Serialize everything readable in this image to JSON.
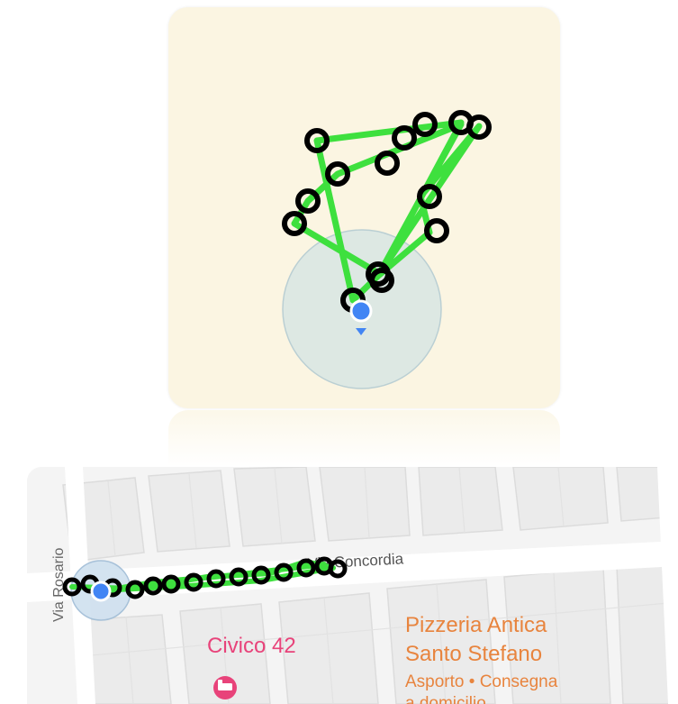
{
  "top_map": {
    "background_color": "#fbf5e2",
    "track_color": "#3ee03e",
    "marker_color": "#000000",
    "location_dot_color": "#4285f4",
    "accuracy_circle_color": "#dce8e4"
  },
  "bottom_map": {
    "streets": {
      "via_concordia": "Via Concordia",
      "via_rosario": "Via Rosario"
    },
    "places": {
      "civico": "Civico 42",
      "pizzeria_line1": "Pizzeria Antica",
      "pizzeria_line2": "Santo Stefano",
      "pizzeria_services": "Asporto • Consegna",
      "pizzeria_services_cont": "a domicilio"
    },
    "place_label_color": "#e8437a",
    "food_label_color": "#e8843e",
    "hotel_icon": "bed-icon",
    "location_dot_color": "#4285f4"
  }
}
